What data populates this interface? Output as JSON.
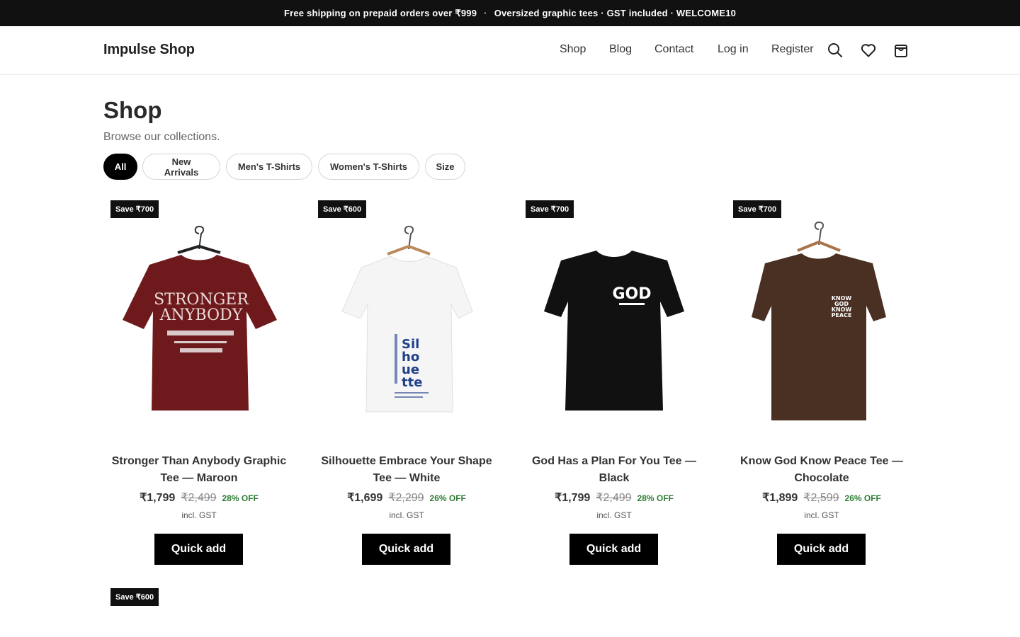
{
  "announcement": {
    "part1": "Free shipping on prepaid orders over ₹999",
    "separator": "·",
    "part2": "Oversized graphic tees · GST included · WELCOME10"
  },
  "header": {
    "logo": "Impulse Shop",
    "nav": [
      "Shop",
      "Blog",
      "Contact",
      "Log in",
      "Register"
    ],
    "icons": [
      "search-icon",
      "heart-icon",
      "bag-icon"
    ]
  },
  "page": {
    "title": "Shop",
    "subtitle": "Browse our collections."
  },
  "filters": [
    {
      "label": "All",
      "active": true
    },
    {
      "label": "New Arrivals",
      "active": false
    },
    {
      "label": "Men's T-Shirts",
      "active": false
    },
    {
      "label": "Women's T-Shirts",
      "active": false
    },
    {
      "label": "Size",
      "active": false
    }
  ],
  "products": [
    {
      "badge": "Save ₹700",
      "title_line1": "Stronger Than Anybody Graphic",
      "title_line2": "Tee — Maroon",
      "price": "₹1,799",
      "compare_price": "₹2,499",
      "discount": "28% OFF",
      "tax_note": "incl. GST",
      "cta": "Quick add",
      "shirt_color": "#6e1a1c"
    },
    {
      "badge": "Save ₹600",
      "title_line1": "Silhouette Embrace Your Shape",
      "title_line2": "Tee — White",
      "price": "₹1,699",
      "compare_price": "₹2,299",
      "discount": "26% OFF",
      "tax_note": "incl. GST",
      "cta": "Quick add",
      "shirt_color": "#f5f5f5"
    },
    {
      "badge": "Save ₹700",
      "title_line1": "God Has a Plan For You Tee —",
      "title_line2": "Black",
      "price": "₹1,799",
      "compare_price": "₹2,499",
      "discount": "28% OFF",
      "tax_note": "incl. GST",
      "cta": "Quick add",
      "shirt_color": "#111111"
    },
    {
      "badge": "Save ₹700",
      "title_line1": "Know God Know Peace Tee —",
      "title_line2": "Chocolate",
      "price": "₹1,899",
      "compare_price": "₹2,599",
      "discount": "26% OFF",
      "tax_note": "incl. GST",
      "cta": "Quick add",
      "shirt_color": "#4a3022"
    },
    {
      "badge": "Save ₹600"
    }
  ],
  "colors": {
    "announcement_bg": "#111111",
    "button_bg": "#000000",
    "discount_green": "#2e7d32"
  }
}
